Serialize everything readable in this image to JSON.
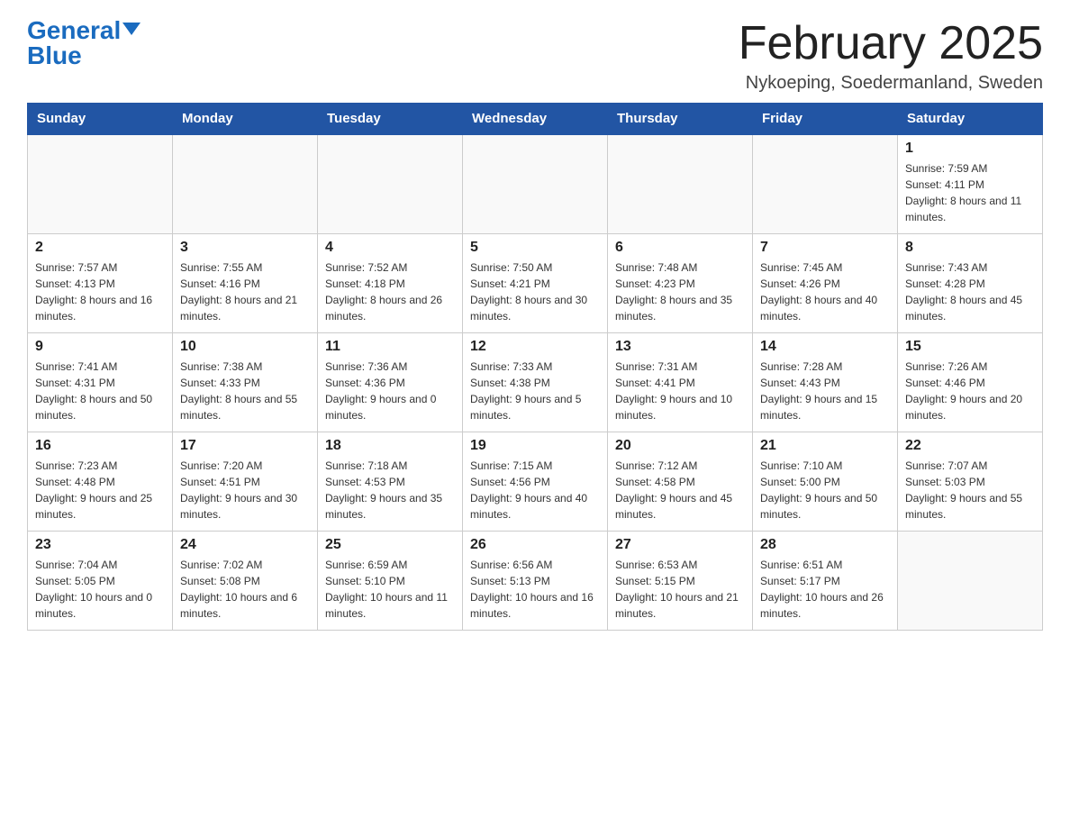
{
  "header": {
    "logo_general": "General",
    "logo_blue": "Blue",
    "month_title": "February 2025",
    "location": "Nykoeping, Soedermanland, Sweden"
  },
  "weekdays": [
    "Sunday",
    "Monday",
    "Tuesday",
    "Wednesday",
    "Thursday",
    "Friday",
    "Saturday"
  ],
  "weeks": [
    [
      {
        "day": "",
        "sunrise": "",
        "sunset": "",
        "daylight": ""
      },
      {
        "day": "",
        "sunrise": "",
        "sunset": "",
        "daylight": ""
      },
      {
        "day": "",
        "sunrise": "",
        "sunset": "",
        "daylight": ""
      },
      {
        "day": "",
        "sunrise": "",
        "sunset": "",
        "daylight": ""
      },
      {
        "day": "",
        "sunrise": "",
        "sunset": "",
        "daylight": ""
      },
      {
        "day": "",
        "sunrise": "",
        "sunset": "",
        "daylight": ""
      },
      {
        "day": "1",
        "sunrise": "Sunrise: 7:59 AM",
        "sunset": "Sunset: 4:11 PM",
        "daylight": "Daylight: 8 hours and 11 minutes."
      }
    ],
    [
      {
        "day": "2",
        "sunrise": "Sunrise: 7:57 AM",
        "sunset": "Sunset: 4:13 PM",
        "daylight": "Daylight: 8 hours and 16 minutes."
      },
      {
        "day": "3",
        "sunrise": "Sunrise: 7:55 AM",
        "sunset": "Sunset: 4:16 PM",
        "daylight": "Daylight: 8 hours and 21 minutes."
      },
      {
        "day": "4",
        "sunrise": "Sunrise: 7:52 AM",
        "sunset": "Sunset: 4:18 PM",
        "daylight": "Daylight: 8 hours and 26 minutes."
      },
      {
        "day": "5",
        "sunrise": "Sunrise: 7:50 AM",
        "sunset": "Sunset: 4:21 PM",
        "daylight": "Daylight: 8 hours and 30 minutes."
      },
      {
        "day": "6",
        "sunrise": "Sunrise: 7:48 AM",
        "sunset": "Sunset: 4:23 PM",
        "daylight": "Daylight: 8 hours and 35 minutes."
      },
      {
        "day": "7",
        "sunrise": "Sunrise: 7:45 AM",
        "sunset": "Sunset: 4:26 PM",
        "daylight": "Daylight: 8 hours and 40 minutes."
      },
      {
        "day": "8",
        "sunrise": "Sunrise: 7:43 AM",
        "sunset": "Sunset: 4:28 PM",
        "daylight": "Daylight: 8 hours and 45 minutes."
      }
    ],
    [
      {
        "day": "9",
        "sunrise": "Sunrise: 7:41 AM",
        "sunset": "Sunset: 4:31 PM",
        "daylight": "Daylight: 8 hours and 50 minutes."
      },
      {
        "day": "10",
        "sunrise": "Sunrise: 7:38 AM",
        "sunset": "Sunset: 4:33 PM",
        "daylight": "Daylight: 8 hours and 55 minutes."
      },
      {
        "day": "11",
        "sunrise": "Sunrise: 7:36 AM",
        "sunset": "Sunset: 4:36 PM",
        "daylight": "Daylight: 9 hours and 0 minutes."
      },
      {
        "day": "12",
        "sunrise": "Sunrise: 7:33 AM",
        "sunset": "Sunset: 4:38 PM",
        "daylight": "Daylight: 9 hours and 5 minutes."
      },
      {
        "day": "13",
        "sunrise": "Sunrise: 7:31 AM",
        "sunset": "Sunset: 4:41 PM",
        "daylight": "Daylight: 9 hours and 10 minutes."
      },
      {
        "day": "14",
        "sunrise": "Sunrise: 7:28 AM",
        "sunset": "Sunset: 4:43 PM",
        "daylight": "Daylight: 9 hours and 15 minutes."
      },
      {
        "day": "15",
        "sunrise": "Sunrise: 7:26 AM",
        "sunset": "Sunset: 4:46 PM",
        "daylight": "Daylight: 9 hours and 20 minutes."
      }
    ],
    [
      {
        "day": "16",
        "sunrise": "Sunrise: 7:23 AM",
        "sunset": "Sunset: 4:48 PM",
        "daylight": "Daylight: 9 hours and 25 minutes."
      },
      {
        "day": "17",
        "sunrise": "Sunrise: 7:20 AM",
        "sunset": "Sunset: 4:51 PM",
        "daylight": "Daylight: 9 hours and 30 minutes."
      },
      {
        "day": "18",
        "sunrise": "Sunrise: 7:18 AM",
        "sunset": "Sunset: 4:53 PM",
        "daylight": "Daylight: 9 hours and 35 minutes."
      },
      {
        "day": "19",
        "sunrise": "Sunrise: 7:15 AM",
        "sunset": "Sunset: 4:56 PM",
        "daylight": "Daylight: 9 hours and 40 minutes."
      },
      {
        "day": "20",
        "sunrise": "Sunrise: 7:12 AM",
        "sunset": "Sunset: 4:58 PM",
        "daylight": "Daylight: 9 hours and 45 minutes."
      },
      {
        "day": "21",
        "sunrise": "Sunrise: 7:10 AM",
        "sunset": "Sunset: 5:00 PM",
        "daylight": "Daylight: 9 hours and 50 minutes."
      },
      {
        "day": "22",
        "sunrise": "Sunrise: 7:07 AM",
        "sunset": "Sunset: 5:03 PM",
        "daylight": "Daylight: 9 hours and 55 minutes."
      }
    ],
    [
      {
        "day": "23",
        "sunrise": "Sunrise: 7:04 AM",
        "sunset": "Sunset: 5:05 PM",
        "daylight": "Daylight: 10 hours and 0 minutes."
      },
      {
        "day": "24",
        "sunrise": "Sunrise: 7:02 AM",
        "sunset": "Sunset: 5:08 PM",
        "daylight": "Daylight: 10 hours and 6 minutes."
      },
      {
        "day": "25",
        "sunrise": "Sunrise: 6:59 AM",
        "sunset": "Sunset: 5:10 PM",
        "daylight": "Daylight: 10 hours and 11 minutes."
      },
      {
        "day": "26",
        "sunrise": "Sunrise: 6:56 AM",
        "sunset": "Sunset: 5:13 PM",
        "daylight": "Daylight: 10 hours and 16 minutes."
      },
      {
        "day": "27",
        "sunrise": "Sunrise: 6:53 AM",
        "sunset": "Sunset: 5:15 PM",
        "daylight": "Daylight: 10 hours and 21 minutes."
      },
      {
        "day": "28",
        "sunrise": "Sunrise: 6:51 AM",
        "sunset": "Sunset: 5:17 PM",
        "daylight": "Daylight: 10 hours and 26 minutes."
      },
      {
        "day": "",
        "sunrise": "",
        "sunset": "",
        "daylight": ""
      }
    ]
  ]
}
